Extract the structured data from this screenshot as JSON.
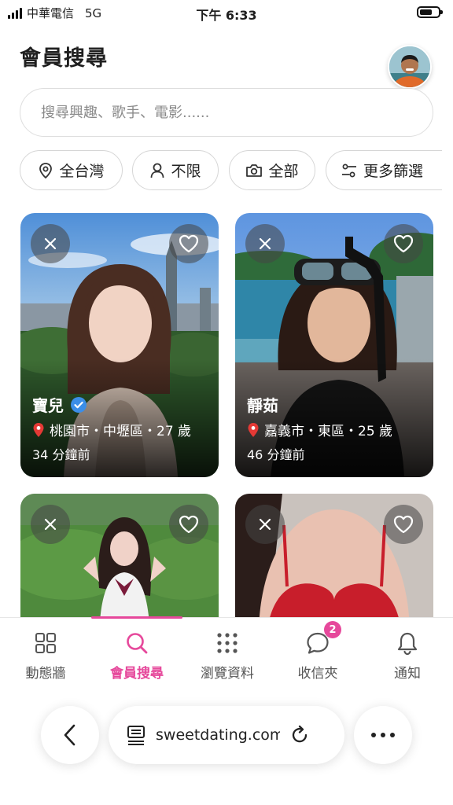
{
  "status_bar": {
    "carrier": "中華電信",
    "network": "5G",
    "time": "下午 6:33"
  },
  "header": {
    "title": "會員搜尋"
  },
  "search": {
    "placeholder": "搜尋興趣、歌手、電影......"
  },
  "filters": [
    {
      "label": "全台灣",
      "icon": "location-pin-icon"
    },
    {
      "label": "不限",
      "icon": "person-icon"
    },
    {
      "label": "全部",
      "icon": "camera-icon"
    },
    {
      "label": "更多篩選",
      "icon": "sliders-icon"
    }
  ],
  "cards": [
    {
      "name": "寶兒",
      "verified": true,
      "location": "桃園市・中壢區・27 歲",
      "last_active": "34 分鐘前"
    },
    {
      "name": "靜茹",
      "verified": false,
      "location": "嘉義市・東區・25 歲",
      "last_active": "46 分鐘前"
    },
    {
      "name": "",
      "verified": false,
      "location": "",
      "last_active": ""
    },
    {
      "name": "",
      "verified": false,
      "location": "",
      "last_active": ""
    }
  ],
  "bottom_nav": {
    "items": [
      {
        "label": "動態牆",
        "icon": "grid-icon",
        "active": false
      },
      {
        "label": "會員搜尋",
        "icon": "search-icon",
        "active": true
      },
      {
        "label": "瀏覽資料",
        "icon": "dots-grid-icon",
        "active": false
      },
      {
        "label": "收信夾",
        "icon": "chat-bubble-icon",
        "active": false,
        "badge": "2"
      },
      {
        "label": "通知",
        "icon": "bell-icon",
        "active": false
      }
    ]
  },
  "browser": {
    "url": "sweetdating.com"
  },
  "colors": {
    "accent": "#e6489b",
    "verified": "#3b8ee8",
    "pin": "#e53935"
  }
}
